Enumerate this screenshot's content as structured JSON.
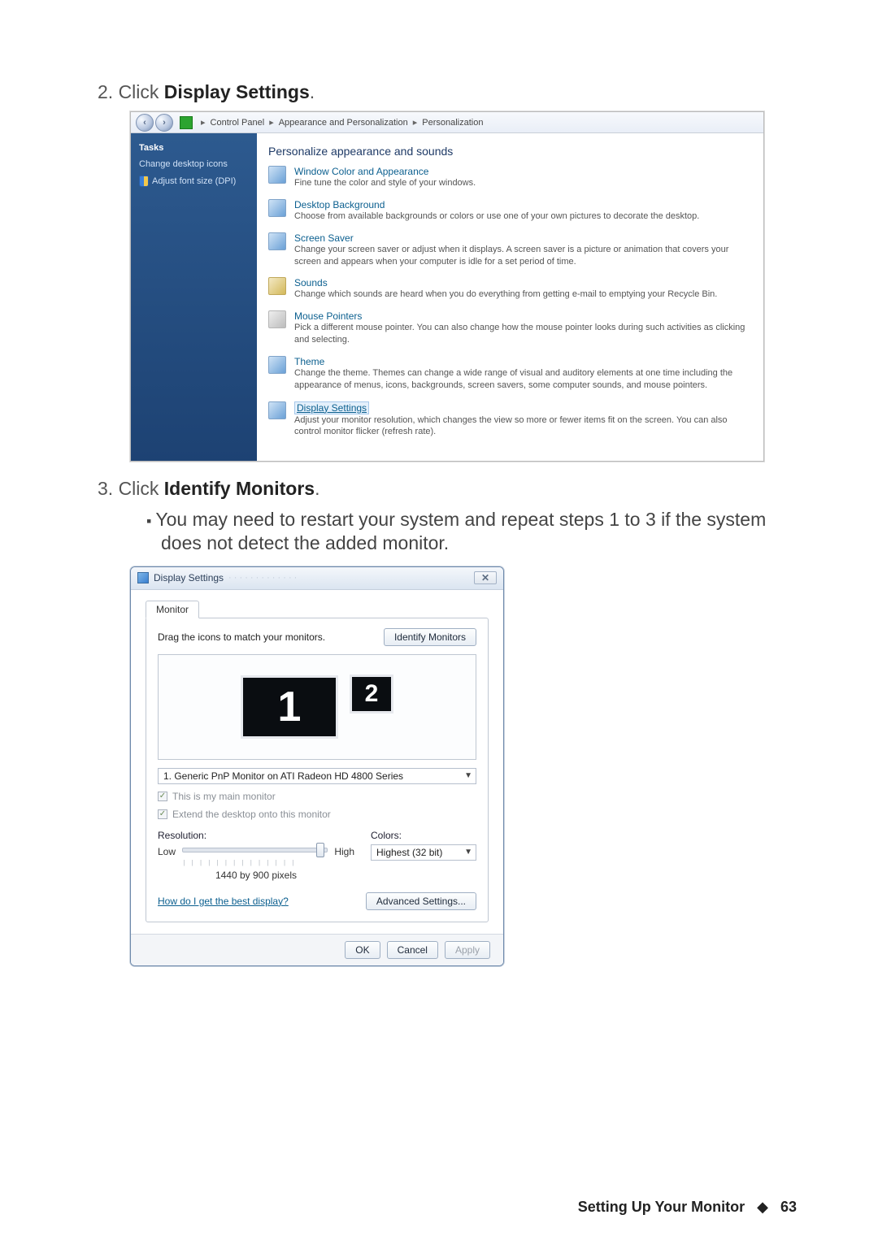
{
  "step2": {
    "prefix": "2. Click ",
    "bold": "Display Settings",
    "suffix": "."
  },
  "step3": {
    "prefix": "3. Click ",
    "bold": "Identify Monitors",
    "suffix": "."
  },
  "bullet": "You may need to restart your system and repeat steps 1 to 3 if the system does not detect the added monitor.",
  "cp": {
    "breadcrumb": {
      "a": "Control Panel",
      "b": "Appearance and Personalization",
      "c": "Personalization"
    },
    "sidebar": {
      "heading": "Tasks",
      "link1": "Change desktop icons",
      "link2": "Adjust font size (DPI)"
    },
    "heading": "Personalize appearance and sounds",
    "items": [
      {
        "title": "Window Color and Appearance",
        "desc": "Fine tune the color and style of your windows."
      },
      {
        "title": "Desktop Background",
        "desc": "Choose from available backgrounds or colors or use one of your own pictures to decorate the desktop."
      },
      {
        "title": "Screen Saver",
        "desc": "Change your screen saver or adjust when it displays. A screen saver is a picture or animation that covers your screen and appears when your computer is idle for a set period of time."
      },
      {
        "title": "Sounds",
        "desc": "Change which sounds are heard when you do everything from getting e-mail to emptying your Recycle Bin."
      },
      {
        "title": "Mouse Pointers",
        "desc": "Pick a different mouse pointer. You can also change how the mouse pointer looks during such activities as clicking and selecting."
      },
      {
        "title": "Theme",
        "desc": "Change the theme. Themes can change a wide range of visual and auditory elements at one time including the appearance of menus, icons, backgrounds, screen savers, some computer sounds, and mouse pointers."
      },
      {
        "title": "Display Settings",
        "desc": "Adjust your monitor resolution, which changes the view so more or fewer items fit on the screen. You can also control monitor flicker (refresh rate)."
      }
    ]
  },
  "ds": {
    "title": "Display Settings",
    "tab": "Monitor",
    "instruct": "Drag the icons to match your monitors.",
    "identify_btn": "Identify Monitors",
    "mon1": "1",
    "mon2": "2",
    "monitor_select": "1. Generic PnP Monitor on ATI Radeon HD 4800 Series",
    "chk_main": "This is my main monitor",
    "chk_extend": "Extend the desktop onto this monitor",
    "res_label": "Resolution:",
    "low": "Low",
    "high": "High",
    "res_value": "1440 by 900 pixels",
    "colors_label": "Colors:",
    "colors_value": "Highest (32 bit)",
    "help": "How do I get the best display?",
    "adv_btn": "Advanced Settings...",
    "ok": "OK",
    "cancel": "Cancel",
    "apply": "Apply"
  },
  "footer": {
    "section": "Setting Up Your Monitor",
    "page": "63"
  }
}
